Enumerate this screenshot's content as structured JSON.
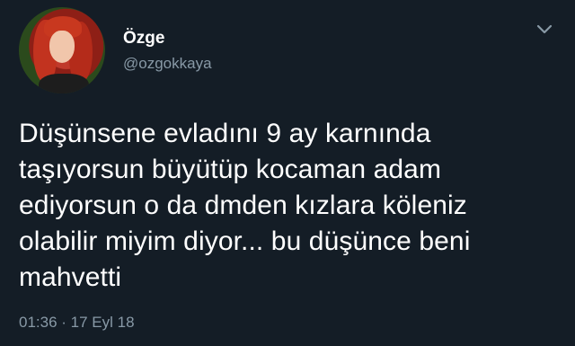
{
  "tweet": {
    "display_name": "Özge",
    "handle": "@ozgokkaya",
    "text_lines": [
      "Düşünsene evladını 9 ay karnında",
      "taşıyorsun büyütüp kocaman adam",
      "ediyorsun o da dmden kızlara köleniz",
      "olabilir miyim diyor... bu düşünce beni",
      "mahvetti"
    ],
    "timestamp": "01:36 · 17 Eyl 18"
  },
  "icons": {
    "more": "chevron-down-icon",
    "avatar": "profile-photo"
  },
  "colors": {
    "background": "#141d26",
    "primary_text": "#ffffff",
    "secondary_text": "#8899a6"
  }
}
